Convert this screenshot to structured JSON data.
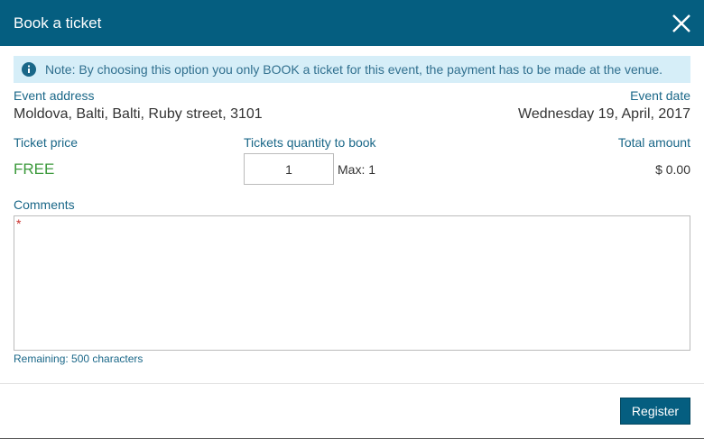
{
  "dialog": {
    "title": "Book a ticket",
    "close_icon": "close-icon"
  },
  "note": {
    "icon": "info-icon",
    "text": "Note: By choosing this option you only BOOK a ticket for this event, the payment has to be made at the venue."
  },
  "event": {
    "address_label": "Event address",
    "address_value": "Moldova, Balti, Balti, Ruby street, 3101",
    "date_label": "Event date",
    "date_value": "Wednesday 19, April, 2017"
  },
  "ticket": {
    "price_label": "Ticket price",
    "price_value": "FREE",
    "quantity_label": "Tickets quantity to book",
    "quantity_value": "1",
    "max_text": "Max: 1",
    "total_label": "Total amount",
    "total_value": "$ 0.00"
  },
  "comments": {
    "label": "Comments",
    "required_marker": "*",
    "remaining_text": "Remaining: 500 characters"
  },
  "footer": {
    "register_label": "Register"
  },
  "colors": {
    "header_bg": "#055e80",
    "note_bg": "#d6eef8",
    "free_green": "#3c9a3c",
    "label_blue": "#1a6788"
  }
}
